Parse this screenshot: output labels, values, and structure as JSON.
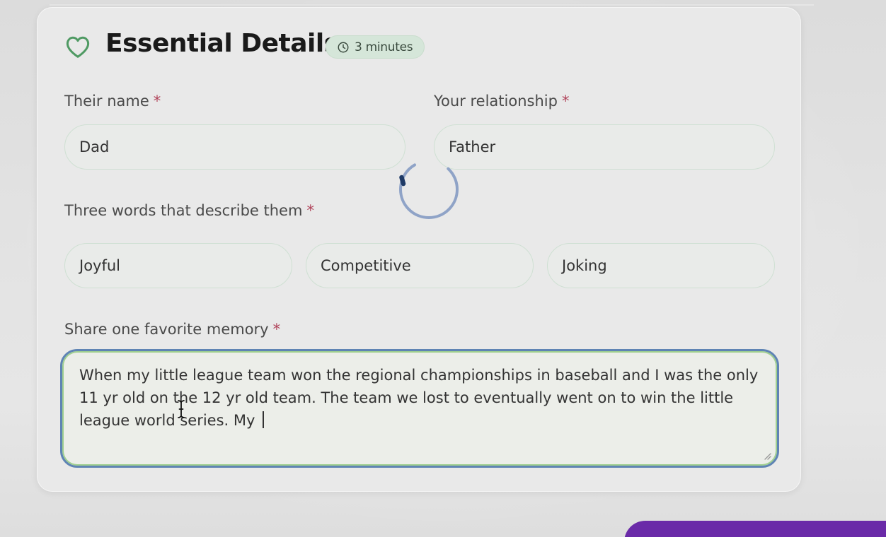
{
  "section": {
    "title": "Essential Details",
    "badge_text": "3 minutes",
    "heart_icon": "heart-outline-icon",
    "clock_icon": "clock-icon"
  },
  "fields": {
    "their_name": {
      "label": "Their name",
      "required_mark": "*",
      "value": "Dad"
    },
    "relationship": {
      "label": "Your relationship",
      "required_mark": "*",
      "value": "Father"
    },
    "three_words": {
      "label": "Three words that describe them",
      "required_mark": "*",
      "values": [
        "Joyful",
        "Competitive",
        "Joking"
      ]
    },
    "memory": {
      "label": "Share one favorite memory",
      "required_mark": "*",
      "value": "When my little league team won the regional championships in baseball and I was the only 11 yr old on the 12 yr old team. The team we lost to eventually went on to win the little league world series. My "
    }
  },
  "status": {
    "loading": true
  },
  "colors": {
    "accent_green": "#4f9a63",
    "required_red": "#b0435a",
    "focus_blue": "#5f84b4",
    "primary_purple": "#6a2aa8"
  }
}
